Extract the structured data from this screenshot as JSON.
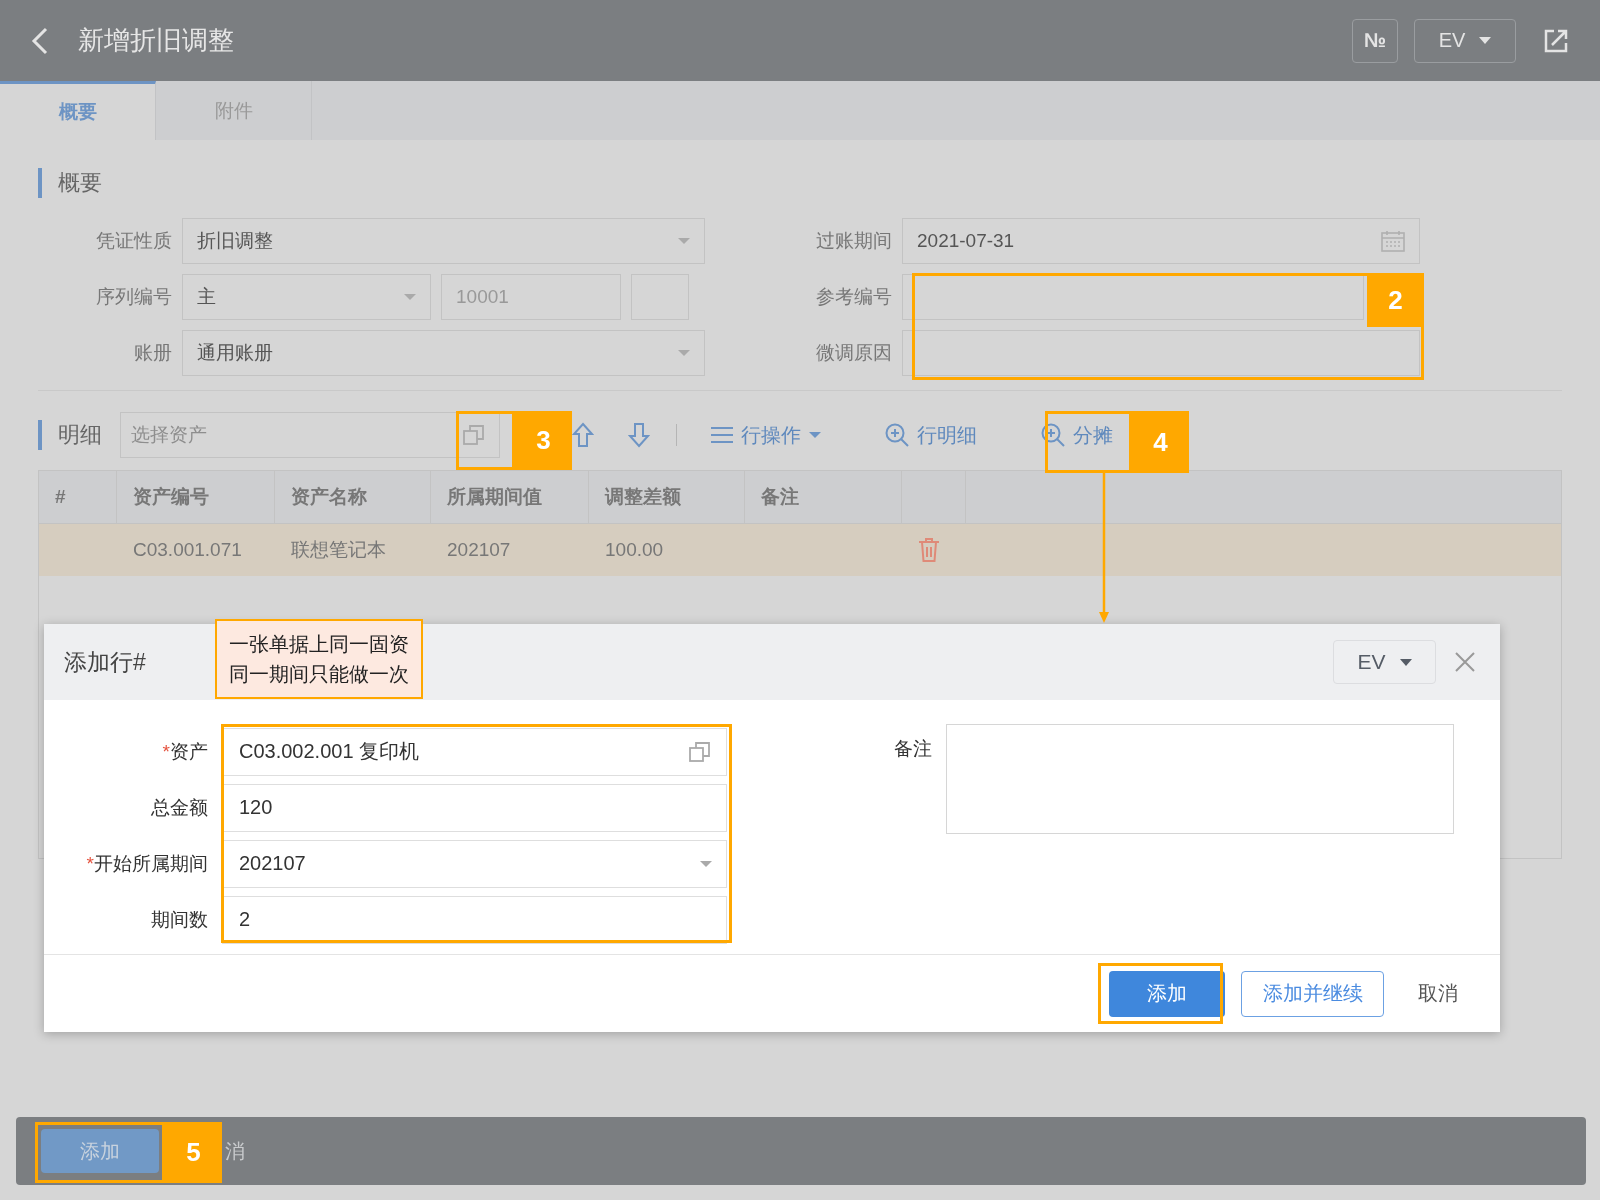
{
  "header": {
    "title": "新增折旧调整",
    "number_button": "№",
    "language": "EV"
  },
  "tabs": [
    {
      "label": "概要",
      "selected": true
    },
    {
      "label": "附件",
      "selected": false
    }
  ],
  "summary": {
    "heading": "概要",
    "fields_left": [
      {
        "label": "凭证性质",
        "kind": "select",
        "value": "折旧调整"
      },
      {
        "label": "序列编号",
        "kind": "sequence",
        "value": "主",
        "number": "10001"
      },
      {
        "label": "账册",
        "kind": "select",
        "value": "通用账册"
      }
    ],
    "fields_right": [
      {
        "label": "过账期间",
        "kind": "date",
        "value": "2021-07-31"
      },
      {
        "label": "参考编号",
        "kind": "text"
      },
      {
        "label": "微调原因",
        "kind": "text"
      }
    ]
  },
  "details": {
    "heading": "明细",
    "asset_picker": {
      "placeholder": "选择资产"
    },
    "toolbar": [
      {
        "kind": "up"
      },
      {
        "kind": "down"
      },
      {
        "kind": "menu",
        "label": "行操作"
      },
      {
        "kind": "zoom",
        "label": "行明细"
      },
      {
        "kind": "zoom",
        "label": "分摊"
      }
    ],
    "table": {
      "columns": [
        "#",
        "资产编号",
        "资产名称",
        "所属期间值",
        "调整差额",
        "备注"
      ],
      "rows": [
        {
          "asset_code": "C03.001.071",
          "asset_name": "联想笔记本",
          "period": "202107",
          "difference": "100.00",
          "selected": true
        }
      ]
    }
  },
  "dialog": {
    "title": "添加行#",
    "language": "EV",
    "fields": [
      {
        "mark": "*",
        "label": "资产",
        "kind": "picker",
        "value": "C03.002.001 复印机"
      },
      {
        "label": "总金额",
        "kind": "text",
        "value": "120"
      },
      {
        "mark": "*",
        "label": "开始所属期间",
        "kind": "select",
        "value": "202107"
      },
      {
        "label": "期间数",
        "kind": "text",
        "value": "2"
      }
    ],
    "note_label": "备注",
    "buttons": [
      {
        "label": "添加",
        "kind": "primary"
      },
      {
        "label": "添加并继续",
        "kind": "outline"
      },
      {
        "label": "取消",
        "kind": "plain"
      }
    ]
  },
  "footer": {
    "buttons": [
      {
        "label": "添加",
        "kind": "primary"
      },
      {
        "label": "消",
        "kind": "plain"
      }
    ]
  },
  "annotations": {
    "note": "一张单据上同一固资同一期间只能做一次",
    "callouts": [
      {
        "number": "2"
      },
      {
        "number": "3"
      },
      {
        "number": "4"
      },
      {
        "number": "5"
      }
    ]
  }
}
